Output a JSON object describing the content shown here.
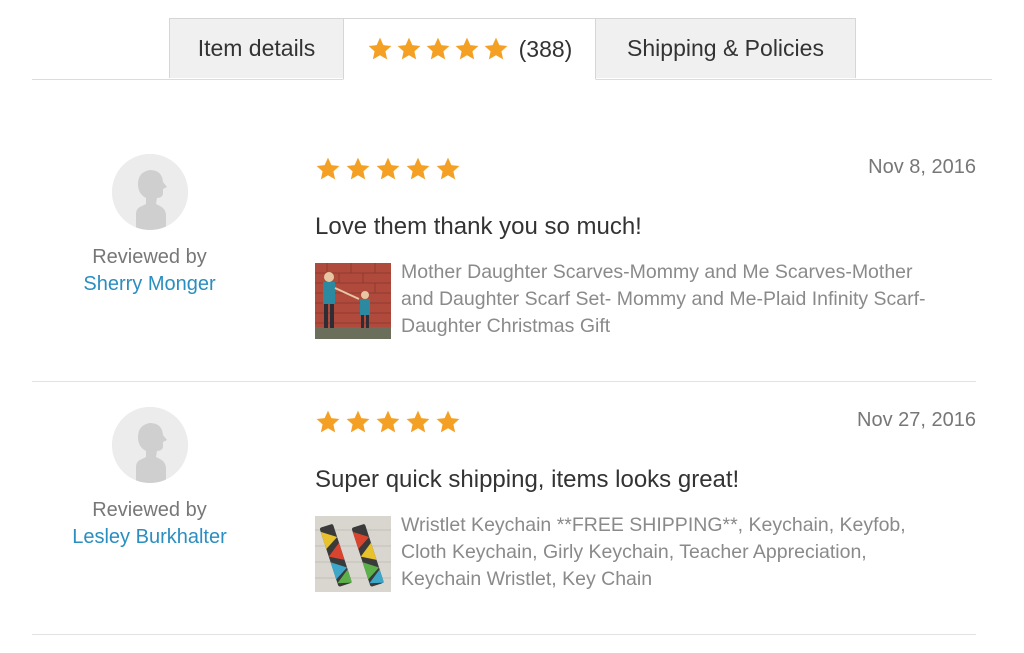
{
  "tabs": {
    "item_details": "Item details",
    "reviews_count": "(388)",
    "reviews_rating": 5,
    "shipping": "Shipping & Policies"
  },
  "colors": {
    "star": "#f4a024",
    "reviewer_link": "#2b8ec0",
    "muted_text": "#8a8a8a"
  },
  "reviews": [
    {
      "rating": 5,
      "date": "Nov 8, 2016",
      "text": "Love them thank you so much!",
      "reviewed_by_label": "Reviewed by",
      "reviewer": "Sherry Monger",
      "listing_title": "Mother Daughter Scarves-Mommy and Me Scarves-Mother and Daughter Scarf Set- Mommy and Me-Plaid Infinity Scarf- Daughter Christmas Gift",
      "thumbnail": "scarf-photo"
    },
    {
      "rating": 5,
      "date": "Nov 27, 2016",
      "text": "Super quick shipping, items looks great!",
      "reviewed_by_label": "Reviewed by",
      "reviewer": "Lesley Burkhalter",
      "listing_title": "Wristlet Keychain **FREE SHIPPING**, Keychain, Keyfob, Cloth Keychain, Girly Keychain, Teacher Appreciation, Keychain Wristlet, Key Chain",
      "thumbnail": "keychain-photo"
    }
  ]
}
